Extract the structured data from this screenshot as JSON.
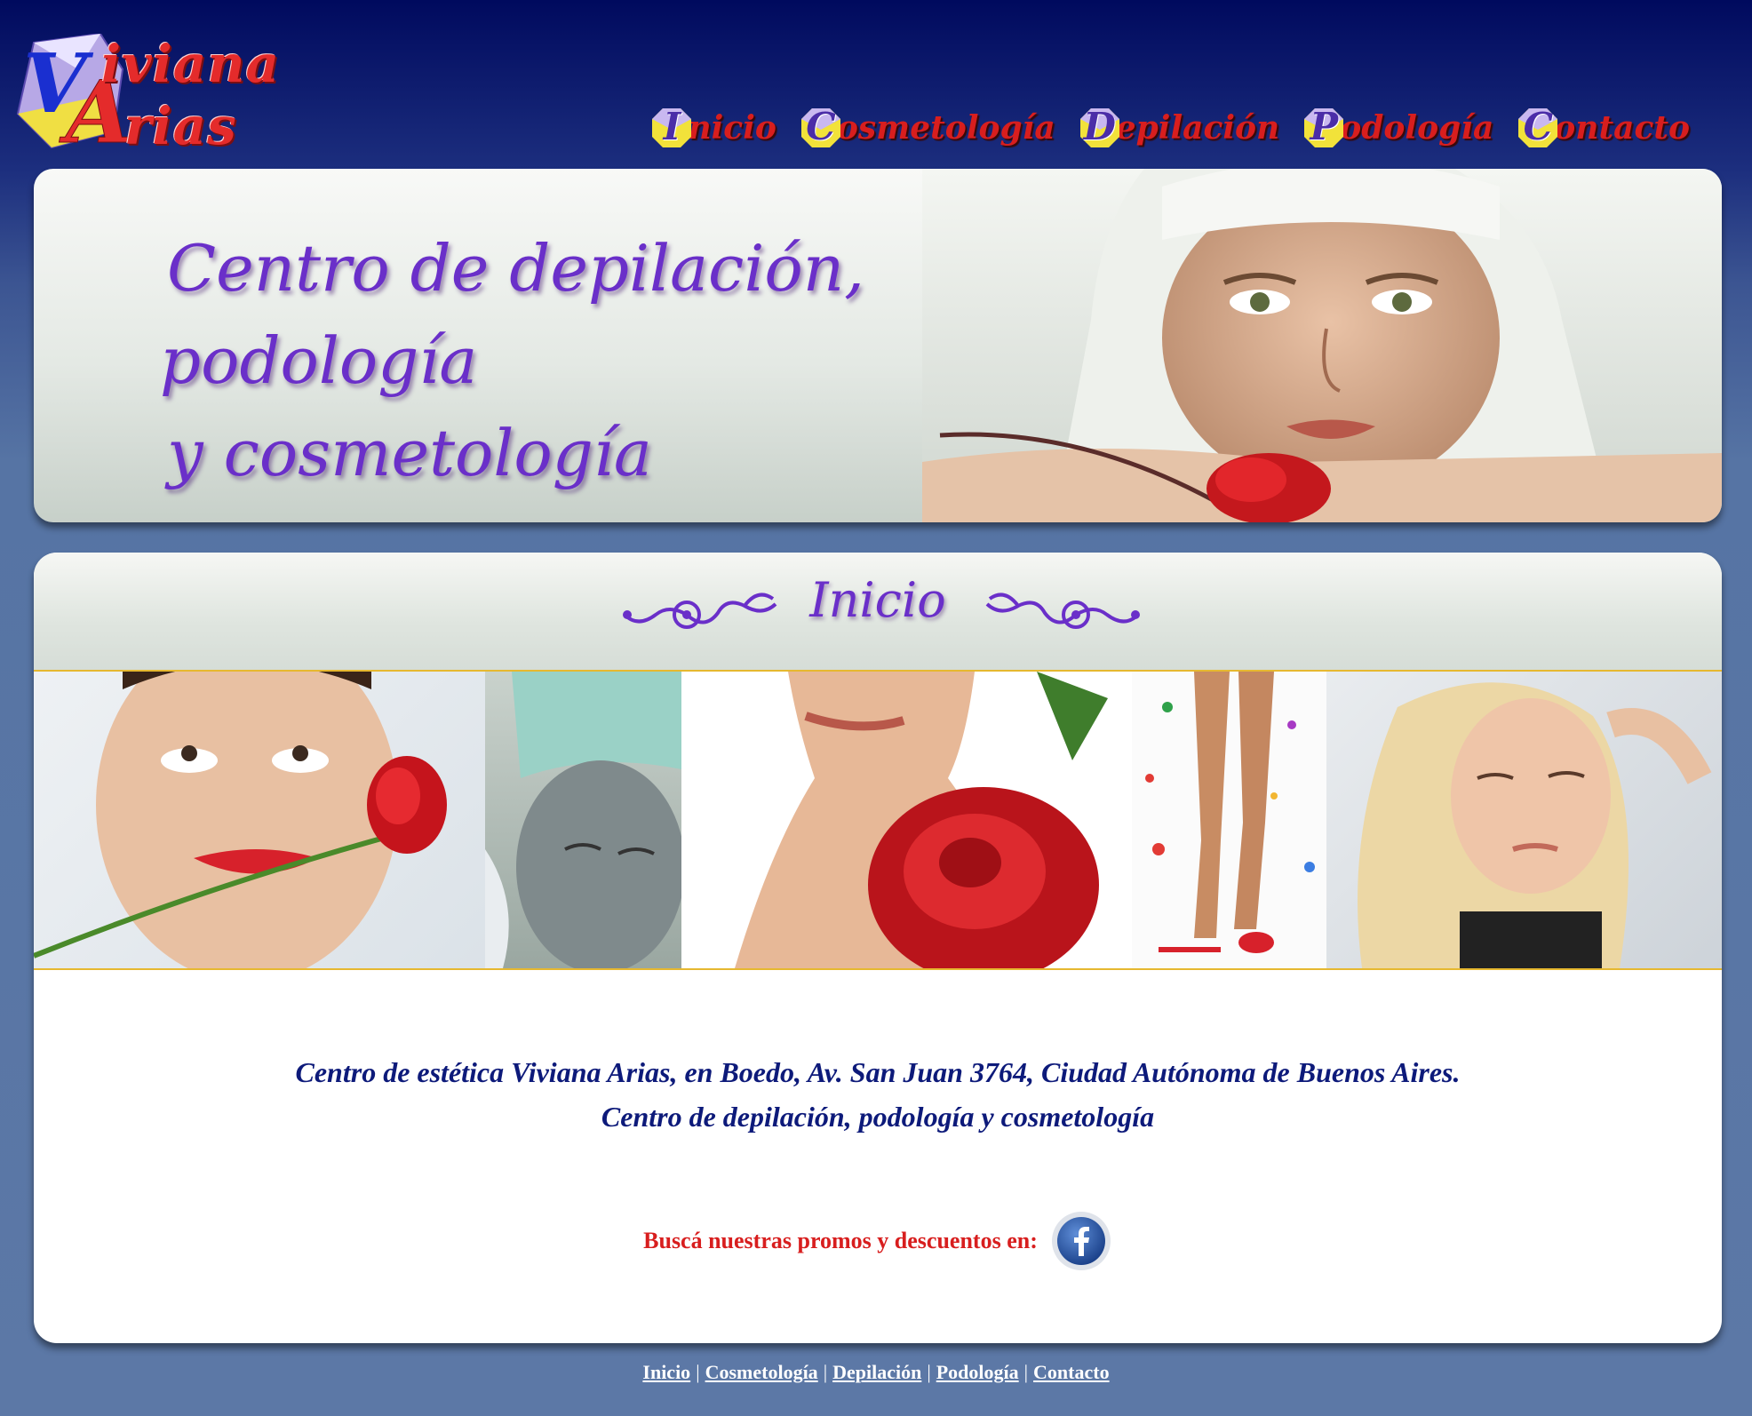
{
  "logo": {
    "line1": "iviana",
    "line2": "rias",
    "initials": "VA"
  },
  "nav": {
    "items": [
      {
        "initial": "I",
        "rest": "nicio"
      },
      {
        "initial": "C",
        "rest": "osmetología"
      },
      {
        "initial": "D",
        "rest": "epilación"
      },
      {
        "initial": "P",
        "rest": "odología"
      },
      {
        "initial": "C",
        "rest": "ontacto"
      }
    ]
  },
  "banner": {
    "lines": [
      "Centro de depilación,",
      "podología",
      "y cosmetología"
    ]
  },
  "section": {
    "title": "Inicio"
  },
  "info": {
    "line1": "Centro de estética Viviana Arias, en Boedo, Av. San Juan 3764, Ciudad Autónoma de Buenos Aires.",
    "line2": "Centro de depilación, podología y cosmetología"
  },
  "promo": {
    "text": "Buscá nuestras promos y descuentos en:",
    "icon": "facebook-icon"
  },
  "footer": {
    "links": [
      "Inicio",
      "Cosmetología",
      "Depilación",
      "Podología",
      "Contacto"
    ],
    "separator": "|"
  },
  "colors": {
    "header_navy": "#000a5e",
    "page_blue": "#5c78a6",
    "accent_purple": "#6a2fc9",
    "accent_red": "#d81e1e",
    "text_navy": "#0d1a7a",
    "divider_gold": "#e6b830"
  }
}
